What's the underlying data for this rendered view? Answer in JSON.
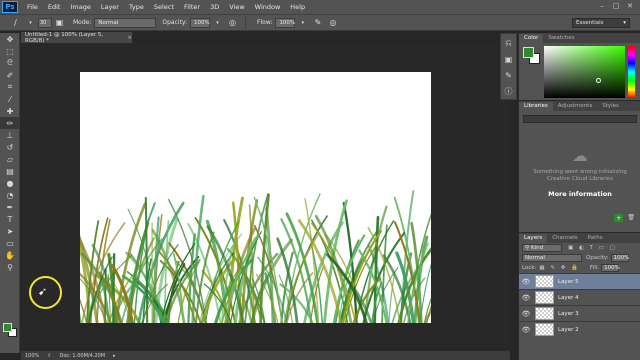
{
  "app": {
    "logo": "Ps"
  },
  "menu": [
    "File",
    "Edit",
    "Image",
    "Layer",
    "Type",
    "Select",
    "Filter",
    "3D",
    "View",
    "Window",
    "Help"
  ],
  "window_controls": [
    "minimize-icon",
    "maximize-icon",
    "close-icon"
  ],
  "options": {
    "brush_size": "30",
    "mode_label": "Mode:",
    "mode_value": "Normal",
    "opacity_label": "Opacity:",
    "opacity_value": "100%",
    "flow_label": "Flow:",
    "flow_value": "100%",
    "workspace": "Essentials"
  },
  "document": {
    "tab_title": "Untitled-1 @ 100% (Layer 5, RGB/8) *",
    "close": "×"
  },
  "tools": [
    "move",
    "marquee",
    "lasso",
    "quick-select",
    "crop",
    "eyedropper",
    "healing",
    "brush",
    "stamp",
    "history-brush",
    "eraser",
    "gradient",
    "blur",
    "dodge",
    "pen",
    "type",
    "path-select",
    "shape",
    "hand",
    "zoom"
  ],
  "colors": {
    "foreground": "#2f8a2f",
    "background": "#ffffff",
    "canvas": "#ffffff",
    "layer_selected": "#6e7f9a"
  },
  "status": {
    "zoom": "100%",
    "doc": "Doc: 1.00M/4.20M"
  },
  "color_panel": {
    "tabs": [
      "Color",
      "Swatches"
    ]
  },
  "libraries_panel": {
    "tabs": [
      "Libraries",
      "Adjustments",
      "Styles"
    ],
    "message": "Something went wrong initializing Creative Cloud Libraries",
    "more_info": "More information"
  },
  "layers_panel": {
    "tabs": [
      "Layers",
      "Channels",
      "Paths"
    ],
    "kind": "Kind",
    "blend_mode": "Normal",
    "opacity_label": "Opacity:",
    "opacity_value": "100%",
    "lock_label": "Lock:",
    "fill_label": "Fill:",
    "fill_value": "100%",
    "layers": [
      {
        "name": "Layer 5",
        "selected": true
      },
      {
        "name": "Layer 4",
        "selected": false
      },
      {
        "name": "Layer 3",
        "selected": false
      },
      {
        "name": "Layer 2",
        "selected": false
      }
    ]
  }
}
